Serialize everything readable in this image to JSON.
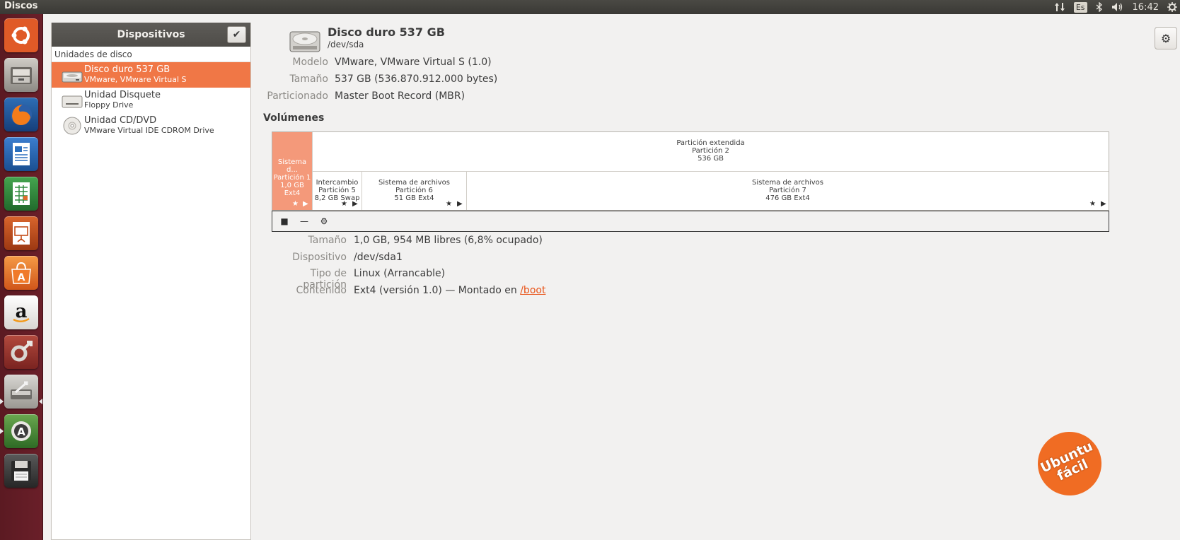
{
  "topbar": {
    "app_title": "Discos",
    "keyboard_layout": "Es",
    "time": "16:42",
    "icons": [
      "network-icon",
      "keyboard-layout-icon",
      "bluetooth-icon",
      "volume-icon",
      "power-gear-icon"
    ]
  },
  "launcher": {
    "items": [
      {
        "name": "ubuntu-dash",
        "color": "#e95420"
      },
      {
        "name": "files",
        "color": "#9a968f"
      },
      {
        "name": "firefox",
        "color": "#e66000"
      },
      {
        "name": "libreoffice-writer",
        "color": "#1e6bb3"
      },
      {
        "name": "libreoffice-calc",
        "color": "#2f8a3c"
      },
      {
        "name": "libreoffice-impress",
        "color": "#c54e1a"
      },
      {
        "name": "software-center",
        "color": "#f37b2a"
      },
      {
        "name": "amazon",
        "color": "#f6f6f6"
      },
      {
        "name": "system-settings",
        "color": "#a23a30"
      },
      {
        "name": "disks",
        "color": "#b8b6b2"
      },
      {
        "name": "software-updater",
        "color": "#4f8c3e"
      },
      {
        "name": "floppy",
        "color": "#3a3a3a"
      }
    ]
  },
  "sidebar": {
    "title": "Dispositivos",
    "section": "Unidades de disco",
    "drives": [
      {
        "name": "Disco duro 537 GB",
        "sub": "VMware, VMware Virtual S",
        "selected": true
      },
      {
        "name": "Unidad Disquete",
        "sub": "Floppy Drive",
        "selected": false
      },
      {
        "name": "Unidad CD/DVD",
        "sub": "VMware Virtual IDE CDROM Drive",
        "selected": false
      }
    ]
  },
  "disk": {
    "title": "Disco duro 537 GB",
    "path": "/dev/sda",
    "props": [
      {
        "label": "Modelo",
        "value": "VMware, VMware Virtual S (1.0)"
      },
      {
        "label": "Tamaño",
        "value": "537 GB (536.870.912.000 bytes)"
      },
      {
        "label": "Particionado",
        "value": "Master Boot Record (MBR)"
      }
    ]
  },
  "volumes": {
    "title": "Volúmenes",
    "partitions": [
      {
        "line1": "Sistema d...",
        "line2": "Partición 1",
        "line3": "1,0 GB Ext4"
      },
      {
        "line1": "Partición extendida",
        "line2": "Partición 2",
        "line3": "536 GB"
      },
      {
        "line1": "Intercambio",
        "line2": "Partición 5",
        "line3": "8,2 GB Swap"
      },
      {
        "line1": "Sistema de archivos",
        "line2": "Partición 6",
        "line3": "51 GB Ext4"
      },
      {
        "line1": "Sistema de archivos",
        "line2": "Partición 7",
        "line3": "476 GB Ext4"
      }
    ]
  },
  "details": {
    "rows": [
      {
        "label": "Tamaño",
        "value": "1,0 GB, 954 MB libres (6,8% ocupado)"
      },
      {
        "label": "Dispositivo",
        "value": "/dev/sda1"
      },
      {
        "label": "Tipo de partición",
        "value": "Linux (Arrancable)"
      },
      {
        "label": "Contenido",
        "value": "Ext4 (versión 1.0) — Montado en ",
        "link": "/boot"
      }
    ]
  },
  "watermark": {
    "line1": "Ubuntu",
    "line2": "fácil"
  },
  "colors": {
    "accent": "#f07746",
    "selected_partition": "#f4997a",
    "link": "#e9551a"
  }
}
